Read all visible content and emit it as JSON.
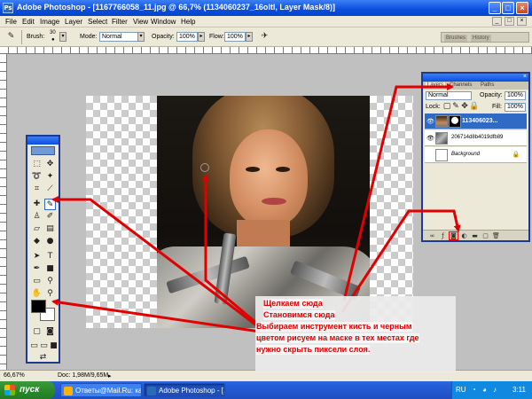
{
  "window": {
    "title": "Adobe Photoshop - [1167766058_11.jpg @ 66,7% (1134060237_16oltl, Layer Mask/8)]",
    "buttons": [
      "_",
      "□",
      "×"
    ]
  },
  "menubar": {
    "items": [
      "File",
      "Edit",
      "Image",
      "Layer",
      "Select",
      "Filter",
      "View",
      "Window",
      "Help"
    ],
    "doc_buttons": [
      "_",
      "□",
      "×"
    ]
  },
  "options_bar": {
    "brush_label": "Brush:",
    "brush_size": "30",
    "mode_label": "Mode:",
    "mode_value": "Normal",
    "opacity_label": "Opacity:",
    "opacity_value": "100%",
    "flow_label": "Flow:",
    "flow_value": "100%",
    "wells_tabs": [
      "Brushes",
      "History"
    ]
  },
  "tools": {
    "icons": [
      "marquee-icon",
      "move-icon",
      "lasso-icon",
      "magic-wand-icon",
      "crop-icon",
      "slice-icon",
      "healing-icon",
      "brush-icon",
      "stamp-icon",
      "history-brush-icon",
      "eraser-icon",
      "gradient-icon",
      "blur-icon",
      "dodge-icon",
      "path-select-icon",
      "type-icon",
      "pen-icon",
      "shape-icon",
      "notes-icon",
      "eyedropper-icon",
      "hand-icon",
      "zoom-icon"
    ],
    "selected_tool": "brush-icon",
    "foreground_color": "#000000",
    "background_color": "#ffffff"
  },
  "layers_panel": {
    "tabs": [
      "Layers",
      "Channels",
      "Paths"
    ],
    "blend_mode": "Normal",
    "opacity_label": "Opacity:",
    "opacity_value": "100%",
    "lock_label": "Lock:",
    "fill_label": "Fill:",
    "fill_value": "100%",
    "layers": [
      {
        "name": "113406023...",
        "selected": true
      },
      {
        "name": "206714d8b4019dfb89",
        "selected": false
      },
      {
        "name": "Background",
        "selected": false
      }
    ]
  },
  "status_bar": {
    "zoom": "66,67%",
    "doc_info": "Doc: 1,98M/9,65M"
  },
  "taskbar": {
    "start_label": "пуск",
    "tasks": [
      "Ответы@Mail.Ru: ка...",
      "Adobe Photoshop - [..."
    ],
    "tray_lang": "RU",
    "clock": "3:11"
  },
  "annotations": {
    "click_here": "Щелкаем сюда",
    "go_here": "Становимся сюда",
    "instruction_line1": "Выбираем инструмент кисть и черным",
    "instruction_line2": "цветом рисуем на маске в тех местах где",
    "instruction_line3": "нужно скрыть пиксели слоя.",
    "color": "#e00000"
  }
}
